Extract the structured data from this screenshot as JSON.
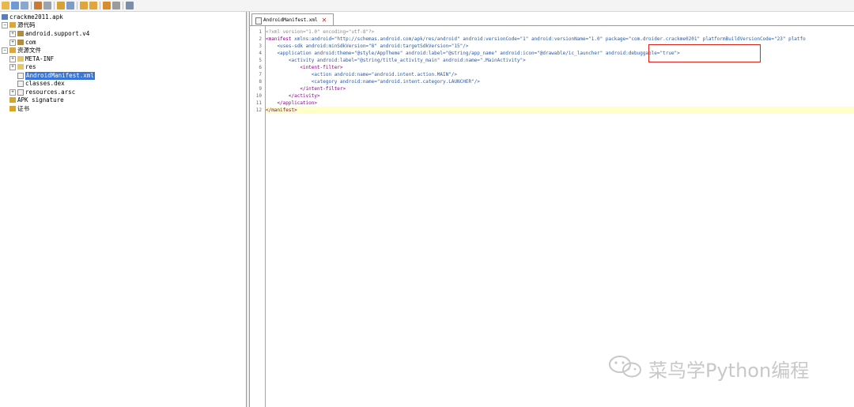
{
  "toolbar": {
    "icons": [
      "open-folder-icon",
      "save-icon",
      "save-all-icon",
      "cut-icon",
      "copy-icon",
      "search-icon",
      "find-icon",
      "back-arrow-icon",
      "forward-arrow-icon",
      "home-icon",
      "export-icon",
      "settings-icon"
    ]
  },
  "tree": {
    "root": "crackme2011.apk",
    "source_code": "源代码",
    "android_support": "android.support.v4",
    "com": "com",
    "resources": "资源文件",
    "meta_inf": "META-INF",
    "res": "res",
    "manifest": "AndroidManifest.xml",
    "classes": "classes.dex",
    "resources_arsc": "resources.arsc",
    "apk_signature": "APK signature",
    "certificate": "证书"
  },
  "editor": {
    "tab_label": "AndroidManifest.xml",
    "line_numbers": [
      "1",
      "2",
      "3",
      "4",
      "5",
      "6",
      "7",
      "8",
      "9",
      "10",
      "11",
      "12"
    ],
    "lines": {
      "l1": "<?xml version=\"1.0\" encoding=\"utf-8\"?>",
      "l2_tag": "<manifest",
      "l2_attrs": " xmlns:android=\"http://schemas.android.com/apk/res/android\" android:versionCode=\"1\" android:versionName=\"1.0\" ",
      "l2_package": "package=\"com.droider.crackme0201\"",
      "l2_rest": " platformBuildVersionCode=\"23\" platfo",
      "l3": "    <uses-sdk android:minSdkVersion=\"8\" android:targetSdkVersion=\"15\"/>",
      "l4": "    <application android:theme=\"@style/AppTheme\" android:label=\"@string/app_name\" android:icon=\"@drawable/ic_launcher\" android:debuggable=\"true\">",
      "l5": "        <activity android:label=\"@string/title_activity_main\" android:name=\".MainActivity\">",
      "l6": "            <intent-filter>",
      "l7": "                <action android:name=\"android.intent.action.MAIN\"/>",
      "l8": "                <category android:name=\"android.intent.category.LAUNCHER\"/>",
      "l9": "            </intent-filter>",
      "l10": "        </activity>",
      "l11": "    </application>",
      "l12": "</manifest>"
    }
  },
  "watermark": {
    "text": "菜鸟学Python编程"
  },
  "colors": {
    "selection": "#3875d7",
    "annotation": "#e0231a",
    "current_line": "#ffffc8",
    "gutter_border": "#7fbf7f"
  }
}
